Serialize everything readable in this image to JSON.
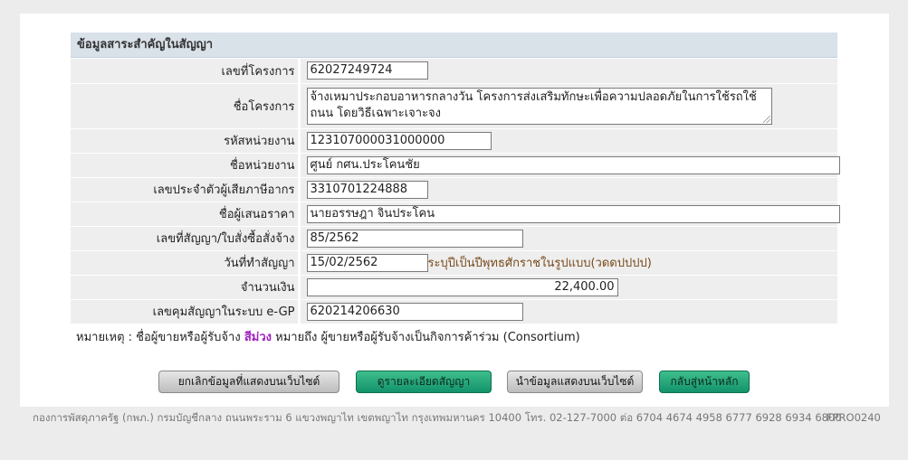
{
  "section": {
    "title": "ข้อมูลสาระสำคัญในสัญญา"
  },
  "fields": {
    "project_no": {
      "label": "เลขที่โครงการ",
      "value": "62027249724"
    },
    "project_name": {
      "label": "ชื่อโครงการ",
      "value": "จ้างเหมาประกอบอาหารกลางวัน โครงการส่งเสริมทักษะเพื่อความปลอดภัยในการใช้รถใช้ถนน โดยวิธีเฉพาะเจาะจง"
    },
    "unit_code": {
      "label": "รหัสหน่วยงาน",
      "value": "123107000031000000"
    },
    "unit_name": {
      "label": "ชื่อหน่วยงาน",
      "value": "ศูนย์ กศน.ประโคนชัย"
    },
    "tax_id": {
      "label": "เลขประจำตัวผู้เสียภาษีอากร",
      "value": "3310701224888"
    },
    "bidder_name": {
      "label": "ชื่อผู้เสนอราคา",
      "value": "นายอรรษฎา จินประโคน"
    },
    "contract_no": {
      "label": "เลขที่สัญญา/ใบสั่งซื้อสั่งจ้าง",
      "value": "85/2562"
    },
    "contract_date": {
      "label": "วันที่ทำสัญญา",
      "value": "15/02/2562",
      "hint": "ระบุปีเป็นปีพุทธศักราชในรูปแบบ(วดดปปปป)"
    },
    "amount": {
      "label": "จำนวนเงิน",
      "value": "22,400.00"
    },
    "egp_no": {
      "label": "เลขคุมสัญญาในระบบ e-GP",
      "value": "620214206630"
    }
  },
  "remark": {
    "prefix": "หมายเหตุ : ชื่อผู้ขายหรือผู้รับจ้าง",
    "highlight": "สีม่วง",
    "suffix": "หมายถึง ผู้ขายหรือผู้รับจ้างเป็นกิจการค้าร่วม (Consortium)",
    "highlight_color": "#a020c0"
  },
  "buttons": {
    "cancel": "ยกเลิกข้อมูลที่แสดงบนเว็บไซต์",
    "details": "ดูรายละเอียดสัญญา",
    "publish": "นำข้อมูลแสดงบนเว็บไซต์",
    "home": "กลับสู่หน้าหลัก"
  },
  "footer": {
    "address": "กองการพัสดุภาครัฐ (กพภ.) กรมบัญชีกลาง ถนนพระราม 6 แขวงพญาไท เขตพญาไท กรุงเทพมหานคร 10400 โทร. 02-127-7000 ต่อ 6704 4674 4958 6777 6928 6934 6800",
    "code": "FPRO0240"
  },
  "colors": {
    "header_bg": "#d9e1e9",
    "row_bg": "#eeeeee",
    "green_button": "#12926a",
    "hint_text": "#7a4a1a"
  }
}
